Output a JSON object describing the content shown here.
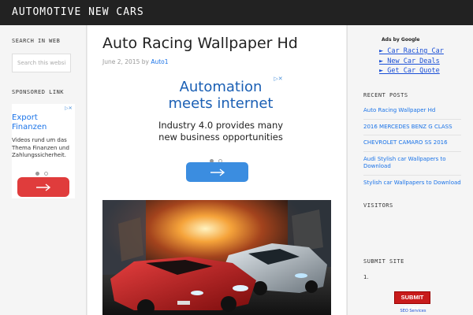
{
  "header": {
    "site_title": "AUTOMOTIVE NEW CARS"
  },
  "left_sidebar": {
    "search_title": "SEARCH IN WEB",
    "search_placeholder": "Search this website",
    "sponsored_title": "SPONSORED LINK",
    "ad": {
      "title": "Export Finanzen",
      "description": "Videos rund um das Thema Finanzen und Zahlungssicherheit.",
      "button_color": "#e03c3c"
    }
  },
  "post": {
    "title": "Auto Racing Wallpaper Hd",
    "date": "June 2, 2015",
    "by": "by",
    "author": "Auto1",
    "ad": {
      "title": "Automation meets internet",
      "description": "Industry 4.0 provides many new business opportunities",
      "button_color": "#3b8de0"
    },
    "image_alt": "racing cars wallpaper"
  },
  "right_sidebar": {
    "ads_by": "Ads by Google",
    "link_units": [
      "► Car Racing Car",
      "► New Car Deals",
      "► Get Car Quote"
    ],
    "recent_title": "RECENT POSTS",
    "recent_posts": [
      "Auto Racing Wallpaper Hd",
      "2016 MERCEDES BENZ G CLASS",
      "CHEVROLET CAMARO SS 2016",
      "Audi Stylish car Wallpapers to Download",
      "Stylish car Wallpapers to Download"
    ],
    "visitors_title": "VISITORS",
    "submit_title": "SUBMIT SITE",
    "submit_list_number": "1.",
    "submit_badge": "SUBMIT FREE",
    "seo_text": "SEO Services"
  },
  "colors": {
    "topbar": "#222222",
    "link": "#1a73e8",
    "ad_close": "#4a90d9"
  },
  "icons": {
    "ad_close": "ad-choices-icon",
    "ad_arrow": "arrow-right-icon"
  }
}
